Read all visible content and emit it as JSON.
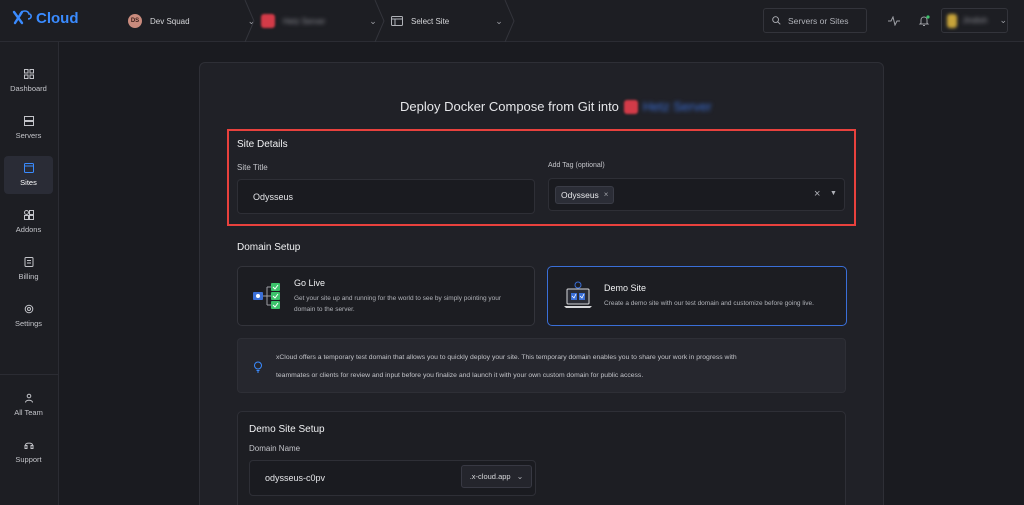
{
  "app": {
    "logo_text": "Cloud"
  },
  "topbar": {
    "team": {
      "initials": "DS",
      "name": "Dev Squad"
    },
    "server": {
      "name": "Hetz Server"
    },
    "site": {
      "label": "Select Site"
    },
    "search": {
      "placeholder": "Servers or Sites"
    },
    "user": {
      "name": "Jindish"
    }
  },
  "sidebar": {
    "items": [
      {
        "label": "Dashboard"
      },
      {
        "label": "Servers"
      },
      {
        "label": "Sites"
      },
      {
        "label": "Addons"
      },
      {
        "label": "Billing"
      },
      {
        "label": "Settings"
      }
    ],
    "bottom_items": [
      {
        "label": "All Team"
      },
      {
        "label": "Support"
      }
    ]
  },
  "page": {
    "title_prefix": "Deploy Docker Compose from Git into",
    "server_name": "Hetz Server"
  },
  "site_details": {
    "heading": "Site Details",
    "site_title_label": "Site Title",
    "site_title_value": "Odysseus",
    "tag_label": "Add Tag (optional)",
    "tag_value": "Odysseus"
  },
  "domain_setup": {
    "heading": "Domain Setup",
    "go_live": {
      "title": "Go Live",
      "desc_line1": "Get your site up and running for the world to see by simply pointing your",
      "desc_line2": "domain to the server."
    },
    "demo_site": {
      "title": "Demo Site",
      "desc": "Create a demo site with our test domain and customize before going live."
    },
    "info_line1": "xCloud offers a temporary test domain that allows you to quickly deploy your site. This temporary domain enables you to share your work in progress with",
    "info_line2": "teammates or clients for review and input before you finalize and launch it with your own custom domain for public access."
  },
  "demo_setup": {
    "heading": "Demo Site Setup",
    "domain_label": "Domain Name",
    "domain_value": "odysseus-c0pv",
    "suffix": ".x-cloud.app"
  },
  "colors": {
    "accent": "#3a8bff",
    "highlight": "#e8413d",
    "selected_border": "#3a6fd8"
  }
}
